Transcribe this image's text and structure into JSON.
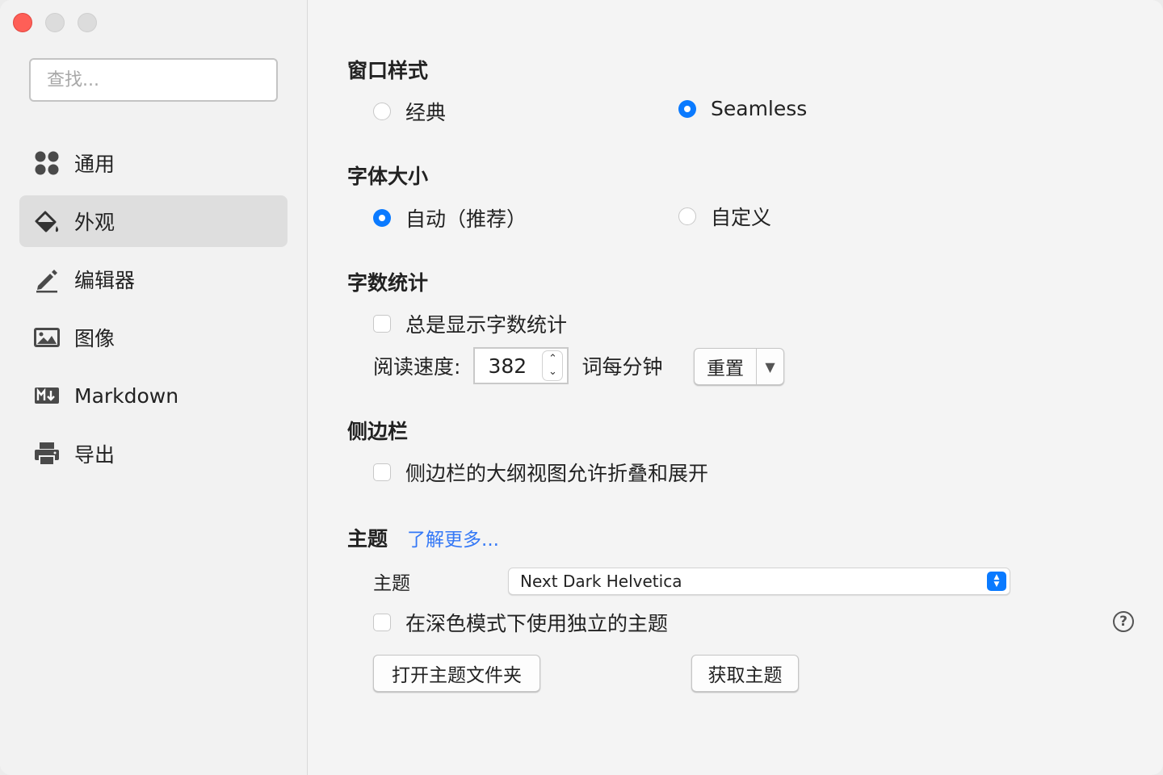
{
  "sidebar": {
    "search_placeholder": "查找...",
    "items": [
      {
        "label": "通用",
        "icon": "grid-dots-icon"
      },
      {
        "label": "外观",
        "icon": "paint-bucket-icon"
      },
      {
        "label": "编辑器",
        "icon": "pencil-icon"
      },
      {
        "label": "图像",
        "icon": "image-icon"
      },
      {
        "label": "Markdown",
        "icon": "markdown-icon"
      },
      {
        "label": "导出",
        "icon": "printer-icon"
      }
    ],
    "active_item": "外观"
  },
  "window_style": {
    "heading": "窗口样式",
    "options": [
      {
        "label": "经典",
        "selected": false
      },
      {
        "label": "Seamless",
        "selected": true
      }
    ]
  },
  "font_size": {
    "heading": "字体大小",
    "options": [
      {
        "label": "自动（推荐）",
        "selected": true
      },
      {
        "label": "自定义",
        "selected": false
      }
    ]
  },
  "word_count": {
    "heading": "字数统计",
    "always_show_label": "总是显示字数统计",
    "always_show_checked": false,
    "reading_speed_label": "阅读速度:",
    "reading_speed_value": "382",
    "reading_speed_unit": "词每分钟",
    "reset_label": "重置"
  },
  "sidebar_section": {
    "heading": "侧边栏",
    "outline_collapse_label": "侧边栏的大纲视图允许折叠和展开",
    "outline_collapse_checked": false
  },
  "theme": {
    "heading": "主题",
    "learn_more": "了解更多...",
    "theme_label": "主题",
    "theme_value": "Next Dark Helvetica",
    "dark_mode_label": "在深色模式下使用独立的主题",
    "dark_mode_checked": false,
    "open_folder_label": "打开主题文件夹",
    "get_themes_label": "获取主题",
    "help_glyph": "?"
  },
  "colors": {
    "accent": "#0a7aff",
    "close_button": "#fe5f57",
    "link": "#3478f6"
  }
}
